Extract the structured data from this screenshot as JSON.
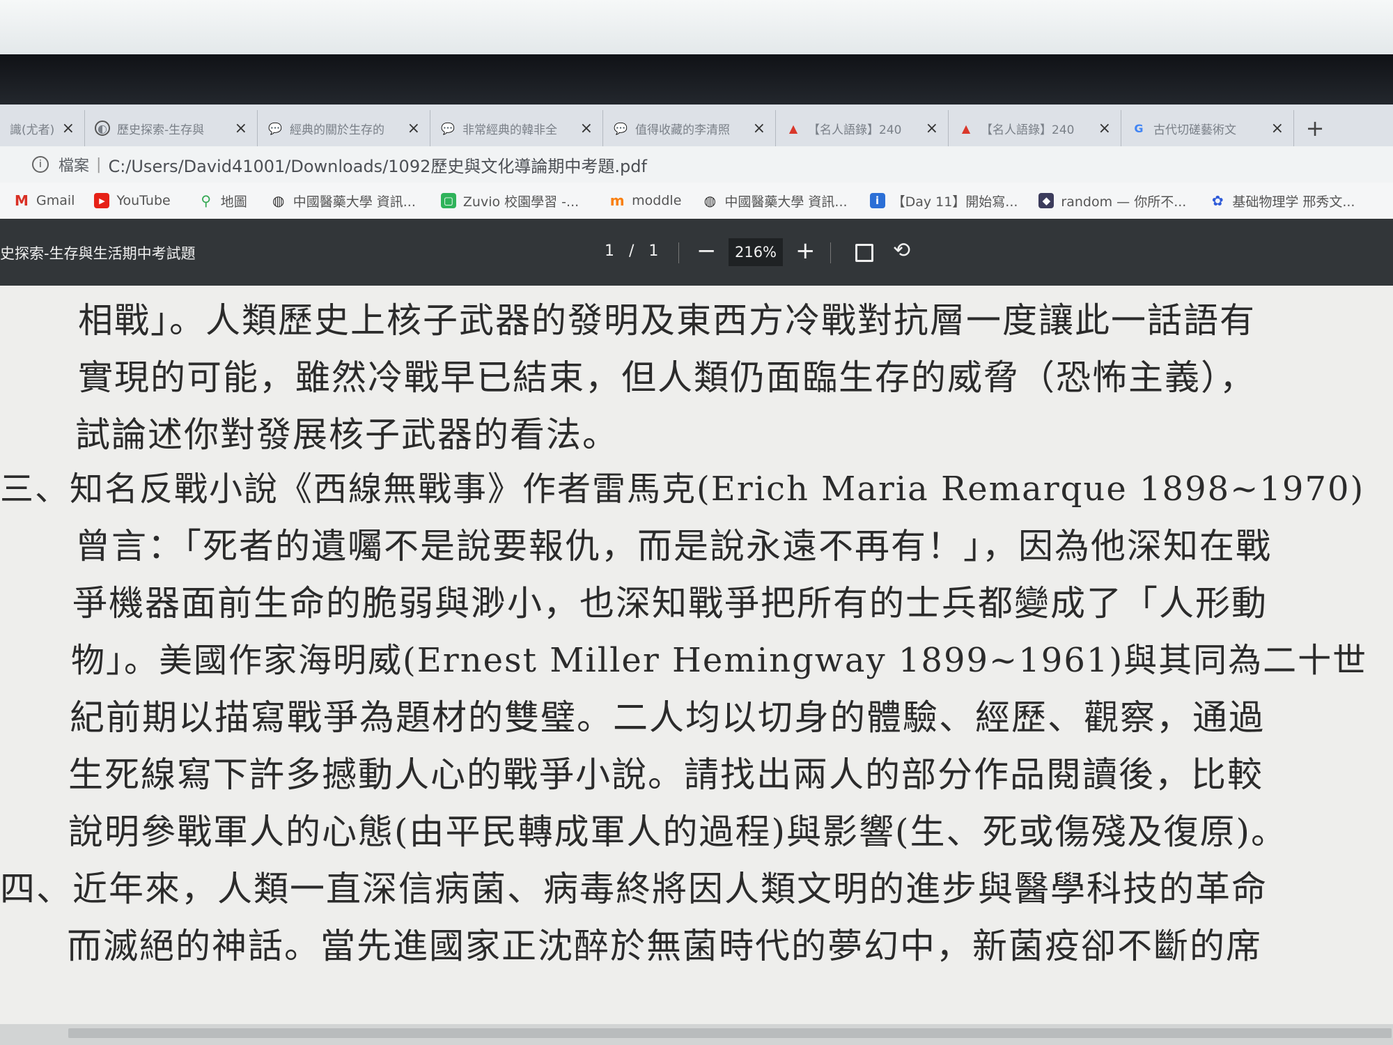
{
  "tabs": [
    {
      "label": "識(尤者)",
      "icon": "document-icon"
    },
    {
      "label": "歷史探索-生存與",
      "icon": "globe-icon"
    },
    {
      "label": "經典的關於生存的",
      "icon": "chat-bubble-icon"
    },
    {
      "label": "非常經典的韓非全",
      "icon": "chat-bubble-icon"
    },
    {
      "label": "值得收藏的李清照",
      "icon": "chat-bubble-icon"
    },
    {
      "label": "【名人語錄】240",
      "icon": "pdf-icon"
    },
    {
      "label": "【名人語錄】240",
      "icon": "pdf-icon"
    },
    {
      "label": "古代切磋藝術文",
      "icon": "google-icon"
    }
  ],
  "new_tab_label": "+",
  "address": {
    "protocol_label": "檔案",
    "url": "C:/Users/David41001/Downloads/1092歷史與文化導論期中考題.pdf"
  },
  "bookmarks": [
    {
      "label": "Gmail",
      "icon": "gmail-icon"
    },
    {
      "label": "YouTube",
      "icon": "youtube-icon"
    },
    {
      "label": "地圖",
      "icon": "map-pin-icon"
    },
    {
      "label": "中國醫藥大學 資訊...",
      "icon": "globe-icon"
    },
    {
      "label": "Zuvio 校園學習 -...",
      "icon": "zuvio-icon"
    },
    {
      "label": "moddle",
      "icon": "moodle-icon"
    },
    {
      "label": "中國醫藥大學 資訊...",
      "icon": "globe-icon"
    },
    {
      "label": "【Day 11】開始寫...",
      "icon": "blog-icon"
    },
    {
      "label": "random — 你所不...",
      "icon": "cube-icon"
    },
    {
      "label": "基础物理学 邢秀文...",
      "icon": "paw-icon"
    }
  ],
  "pdf_toolbar": {
    "title": "史探索-生存與生活期中考試題",
    "page_current": "1",
    "page_sep": "/",
    "page_total": "1",
    "zoom_out": "−",
    "zoom": "216%",
    "zoom_in": "+"
  },
  "document": {
    "lines": [
      "相戰」。人類歷史上核子武器的發明及東西方冷戰對抗層一度讓此一話語有",
      "實現的可能，雖然冷戰早已結束，但人類仍面臨生存的威脅（恐怖主義），",
      "試論述你對發展核子武器的看法。",
      "三、知名反戰小說《西線無戰事》作者雷馬克(Erich Maria Remarque 1898~1970)",
      "曾言：「死者的遺囑不是說要報仇，而是說永遠不再有！」，因為他深知在戰",
      "爭機器面前生命的脆弱與渺小，也深知戰爭把所有的士兵都變成了「人形動",
      "物」。美國作家海明威(Ernest Miller Hemingway 1899~1961)與其同為二十世",
      "紀前期以描寫戰爭為題材的雙璧。二人均以切身的體驗、經歷、觀察，通過",
      "生死線寫下許多撼動人心的戰爭小說。請找出兩人的部分作品閱讀後，比較",
      "說明參戰軍人的心態(由平民轉成軍人的過程)與影響(生、死或傷殘及復原)。",
      "四、近年來，人類一直深信病菌、病毒終將因人類文明的進步與醫學科技的革命",
      "而滅絕的神話。當先進國家正沈醉於無菌時代的夢幻中，新菌疫卻不斷的席"
    ]
  },
  "colors": {
    "tab_strip": "#dde1e7",
    "pdf_toolbar": "#323639",
    "document_bg": "#eeeeec",
    "text": "#2b2b2b"
  }
}
